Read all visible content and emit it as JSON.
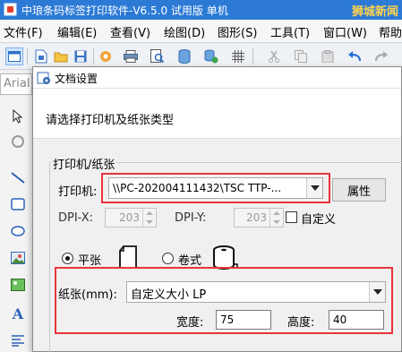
{
  "app": {
    "title": "中琅条码标签打印软件-V6.5.0 试用版 单机",
    "watermark": "狮城新闻"
  },
  "menu": [
    "文件(F)",
    "编辑(E)",
    "查看(V)",
    "绘图(D)",
    "图形(S)",
    "工具(T)",
    "窗口(W)",
    "帮助"
  ],
  "toolbar": {
    "font_field": "Arial"
  },
  "dialog": {
    "title": "文档设置",
    "prompt": "请选择打印机及纸张类型",
    "group_label": "打印机/纸张",
    "printer_label": "打印机:",
    "printer_value": "\\\\PC-202004111432\\TSC TTP-...",
    "properties_button": "属性",
    "dpi_x_label": "DPI-X:",
    "dpi_x_value": "203",
    "dpi_y_label": "DPI-Y:",
    "dpi_y_value": "203",
    "custom_label": "自定义",
    "custom_checked": false,
    "sheet_label": "平张",
    "roll_label": "卷式",
    "paper_type_selected": "平张",
    "paper_label": "纸张(mm):",
    "paper_value": "自定义大小 LP",
    "width_label": "宽度:",
    "width_value": "75",
    "height_label": "高度:",
    "height_value": "40"
  },
  "colors": {
    "titlebar": "#2c7ad6",
    "highlight": "#e8343b",
    "watermark": "#ffd34d"
  }
}
